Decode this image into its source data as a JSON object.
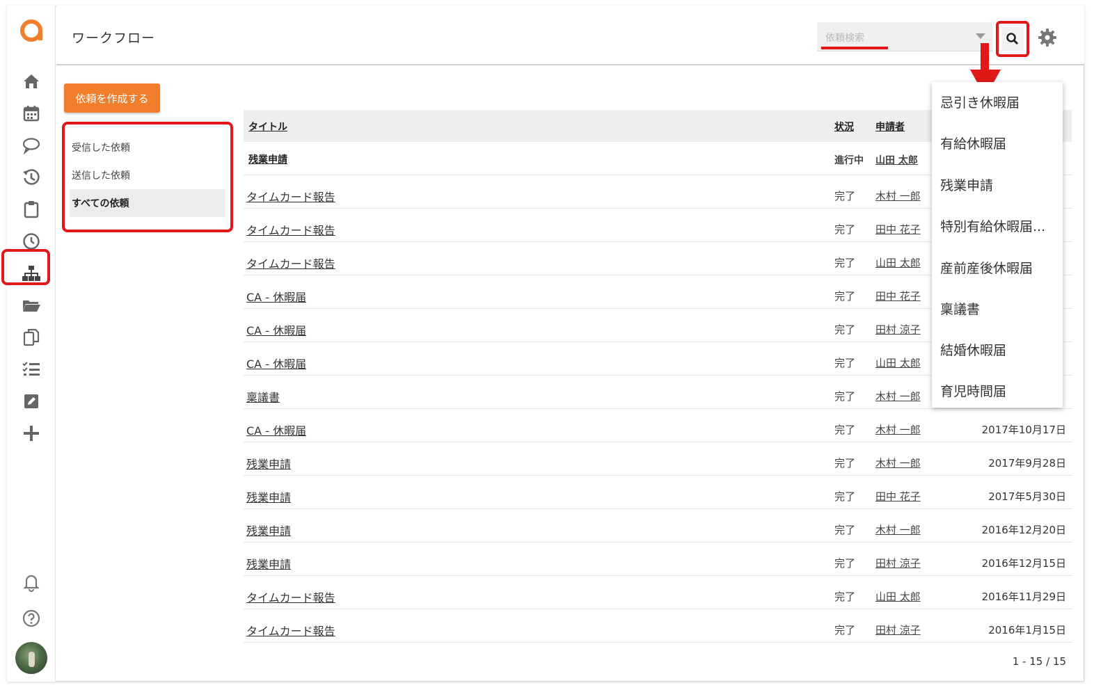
{
  "header": {
    "title": "ワークフロー",
    "search_placeholder": "依頼検索"
  },
  "actions": {
    "create_label": "依頼を作成する"
  },
  "filters": [
    {
      "label": "受信した依頼",
      "active": false
    },
    {
      "label": "送信した依頼",
      "active": false
    },
    {
      "label": "すべての依頼",
      "active": true
    }
  ],
  "table": {
    "columns": [
      "タイトル",
      "状況",
      "申請者"
    ],
    "rows": [
      {
        "title": "残業申請",
        "status": "進行中",
        "applicant": "山田 太郎",
        "date": ""
      },
      {
        "title": "タイムカード報告",
        "status": "完了",
        "applicant": "木村 一郎",
        "date": ""
      },
      {
        "title": "タイムカード報告",
        "status": "完了",
        "applicant": "田中 花子",
        "date": ""
      },
      {
        "title": "タイムカード報告",
        "status": "完了",
        "applicant": "山田 太郎",
        "date": ""
      },
      {
        "title": "CA - 休暇届",
        "status": "完了",
        "applicant": "田中 花子",
        "date": ""
      },
      {
        "title": "CA - 休暇届",
        "status": "完了",
        "applicant": "田村 涼子",
        "date": ""
      },
      {
        "title": "CA - 休暇届",
        "status": "完了",
        "applicant": "山田 太郎",
        "date": ""
      },
      {
        "title": "稟議書",
        "status": "完了",
        "applicant": "木村 一郎",
        "date": ""
      },
      {
        "title": "CA - 休暇届",
        "status": "完了",
        "applicant": "木村 一郎",
        "date": "2017年10月17日"
      },
      {
        "title": "残業申請",
        "status": "完了",
        "applicant": "木村 一郎",
        "date": "2017年9月28日"
      },
      {
        "title": "残業申請",
        "status": "完了",
        "applicant": "田中 花子",
        "date": "2017年5月30日"
      },
      {
        "title": "残業申請",
        "status": "完了",
        "applicant": "木村 一郎",
        "date": "2016年12月20日"
      },
      {
        "title": "残業申請",
        "status": "完了",
        "applicant": "田村 涼子",
        "date": "2016年12月15日"
      },
      {
        "title": "タイムカード報告",
        "status": "完了",
        "applicant": "山田 太郎",
        "date": "2016年11月29日"
      },
      {
        "title": "タイムカード報告",
        "status": "完了",
        "applicant": "田村 涼子",
        "date": "2016年1月15日"
      }
    ],
    "pager": "1 - 15 / 15"
  },
  "dropdown": {
    "items": [
      "忌引き休暇届",
      "有給休暇届",
      "残業申請",
      "特別有給休暇届...",
      "産前産後休暇届",
      "稟議書",
      "結婚休暇届",
      "育児時間届"
    ]
  },
  "sidebar": {
    "icons": [
      "home-icon",
      "calendar-icon",
      "chat-icon",
      "history-icon",
      "clipboard-icon",
      "clock-icon",
      "workflow-icon",
      "folder-icon",
      "copy-icon",
      "checklist-icon",
      "edit-icon",
      "plus-icon",
      "bell-icon",
      "help-icon"
    ]
  },
  "colors": {
    "accent": "#f07e2b",
    "highlight": "#e01818",
    "icon": "#666666"
  }
}
